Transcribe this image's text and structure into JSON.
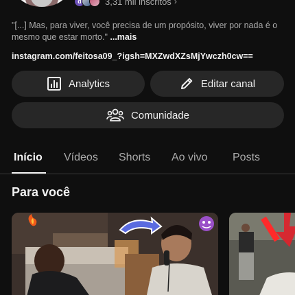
{
  "channel": {
    "subscribers_text": "3,31 mil inscritos",
    "subscriber_avatar_letter": "d",
    "description": "\"[...] Mas, para viver, você precisa de um propósito, viver por nada é o mesmo que estar morto.\"",
    "description_more": "...mais",
    "link": "instagram.com/feitosa09_?igsh=MXZwdXZsMjYwczh0cw=="
  },
  "buttons": {
    "analytics": "Analytics",
    "edit_channel": "Editar canal",
    "community": "Comunidade"
  },
  "tabs": [
    "Início",
    "Vídeos",
    "Shorts",
    "Ao vivo",
    "Posts"
  ],
  "active_tab": "Início",
  "section": {
    "title": "Para você"
  },
  "colors": {
    "background": "#0f0f0f",
    "button_bg": "#272727",
    "secondary_text": "#aaaaaa",
    "primary_text": "#f1f1f1",
    "arrow_blue": "#5a6be0",
    "arrow_red": "#e0202a"
  }
}
